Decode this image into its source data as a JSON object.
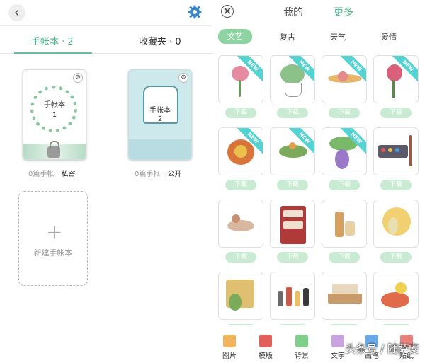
{
  "left": {
    "tabs": [
      {
        "label": "手帐本 · 2"
      },
      {
        "label": "收藏夹 · 0"
      }
    ],
    "books": [
      {
        "title_line1": "手帐本",
        "title_line2": "1",
        "count": "0篇手帐",
        "privacy": "私密"
      },
      {
        "title_line1": "手帐本",
        "title_line2": "2",
        "count": "0篇手帐",
        "privacy": "公开"
      }
    ],
    "new_book_label": "新建手帐本"
  },
  "right": {
    "tabs": [
      {
        "label": "我的"
      },
      {
        "label": "更多"
      }
    ],
    "categories": [
      "文艺",
      "复古",
      "天气",
      "爱情"
    ],
    "download_label": "下载",
    "new_badge": "NEW",
    "toolbar": [
      {
        "label": "图片",
        "color": "#f2b45a"
      },
      {
        "label": "模版",
        "color": "#e0605a"
      },
      {
        "label": "背景",
        "color": "#7fcf8a"
      },
      {
        "label": "文字",
        "color": "#c9a3e0"
      },
      {
        "label": "画笔",
        "color": "#6aa9e8"
      },
      {
        "label": "贴纸",
        "color": "#e8807a"
      }
    ]
  },
  "colors": {
    "accent": "#4fb68a",
    "new_ribbon": "#55d3d3",
    "download_btn": "#c9ebd3"
  },
  "watermark": "头条号 / 随萨安"
}
